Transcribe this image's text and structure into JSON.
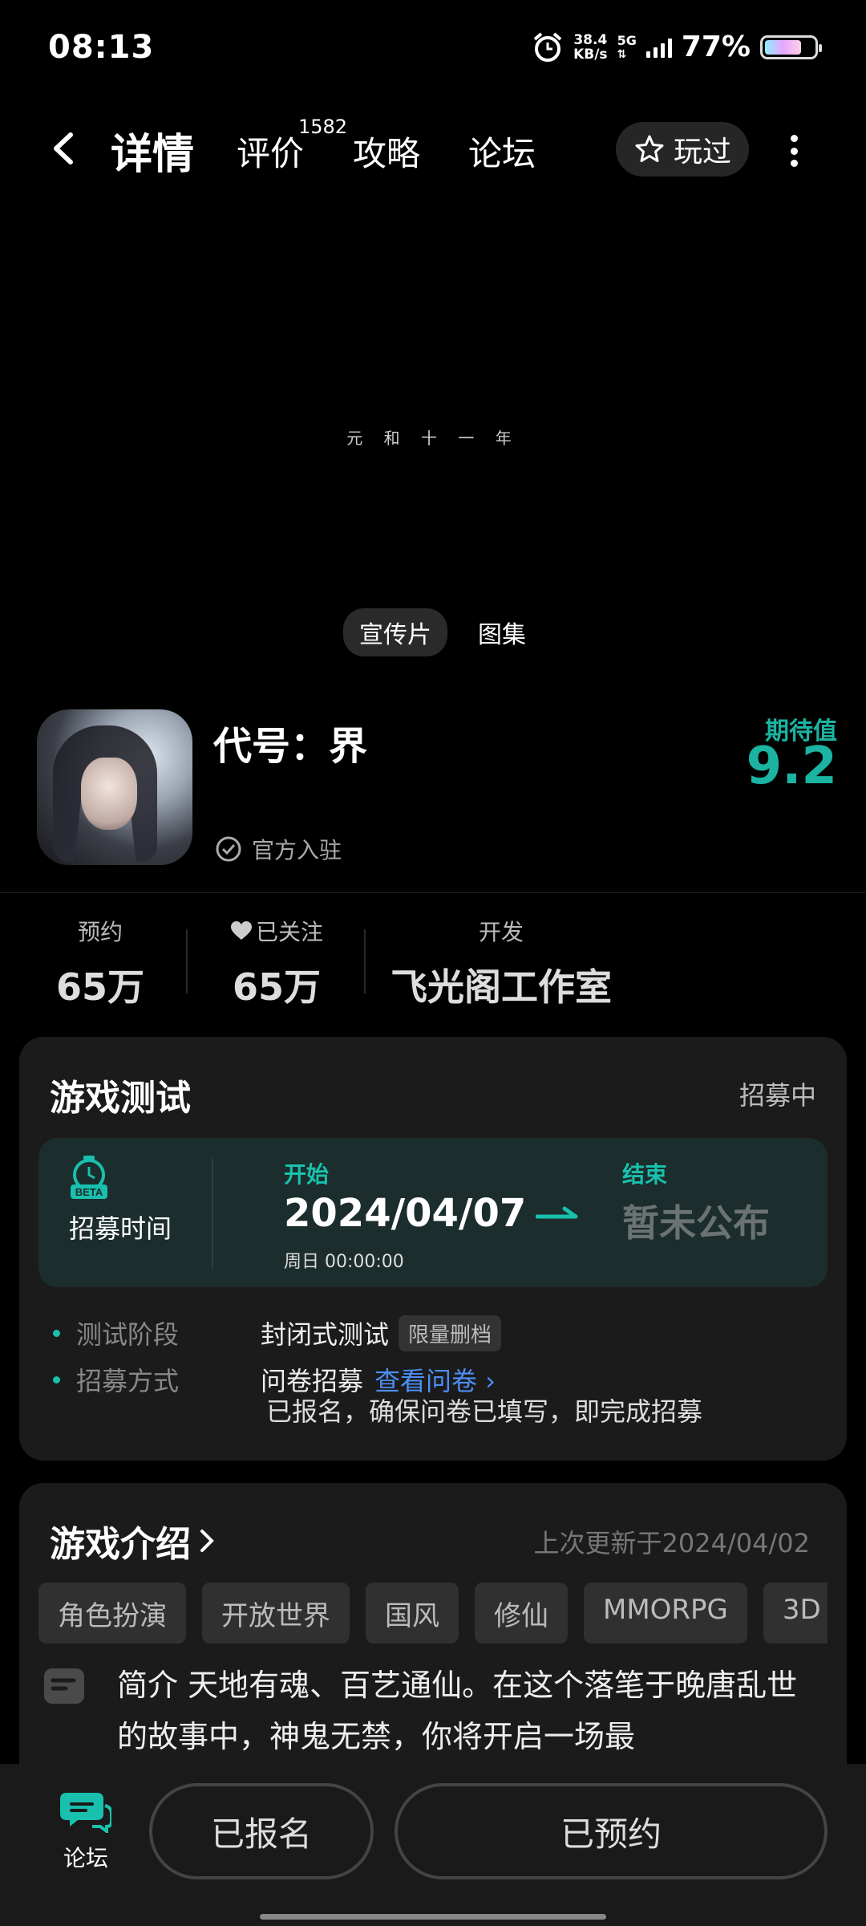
{
  "status_bar": {
    "time": "08:13",
    "speed_top": "38.4",
    "speed_unit": "KB/s",
    "network": "5G",
    "battery": "77%"
  },
  "nav": {
    "tabs": [
      {
        "label": "详情"
      },
      {
        "label": "评价"
      },
      {
        "label": "攻略"
      },
      {
        "label": "论坛"
      }
    ],
    "review_count": "1582",
    "played_label": "玩过"
  },
  "media": {
    "caption": "元 和 十 一 年",
    "tabs": [
      "宣传片",
      "图集"
    ]
  },
  "game": {
    "title": "代号：界",
    "official_label": "官方入驻",
    "expect_label": "期待值",
    "expect_value": "9.2"
  },
  "stats": {
    "reserve_label": "预约",
    "reserve_value": "65万",
    "follow_label": "已关注",
    "follow_value": "65万",
    "dev_label": "开发",
    "dev_value": "飞光阁工作室"
  },
  "test_card": {
    "title": "游戏测试",
    "status": "招募中",
    "recruit_label": "招募时间",
    "start_label": "开始",
    "start_date": "2024/04/07",
    "start_sub": "周日  00:00:00",
    "end_label": "结束",
    "end_value": "暂未公布",
    "phase_key": "测试阶段",
    "phase_value": "封闭式测试",
    "phase_tag": "限量删档",
    "method_key": "招募方式",
    "method_value": "问卷招募",
    "method_link": "查看问卷",
    "note": "已报名，确保问卷已填写，即完成招募"
  },
  "intro_card": {
    "title": "游戏介绍",
    "updated": "上次更新于2024/04/02",
    "tags": [
      "角色扮演",
      "开放世界",
      "国风",
      "修仙",
      "MMORPG",
      "3D"
    ],
    "text": "简介 天地有魂、百艺通仙。在这个落笔于晚唐乱世的故事中，神鬼无禁，你将开启一场最"
  },
  "bottom": {
    "forum_label": "论坛",
    "signed_label": "已报名",
    "reserved_label": "已预约"
  },
  "colors": {
    "accent": "#1bb3a1",
    "link": "#4d8ef5"
  }
}
